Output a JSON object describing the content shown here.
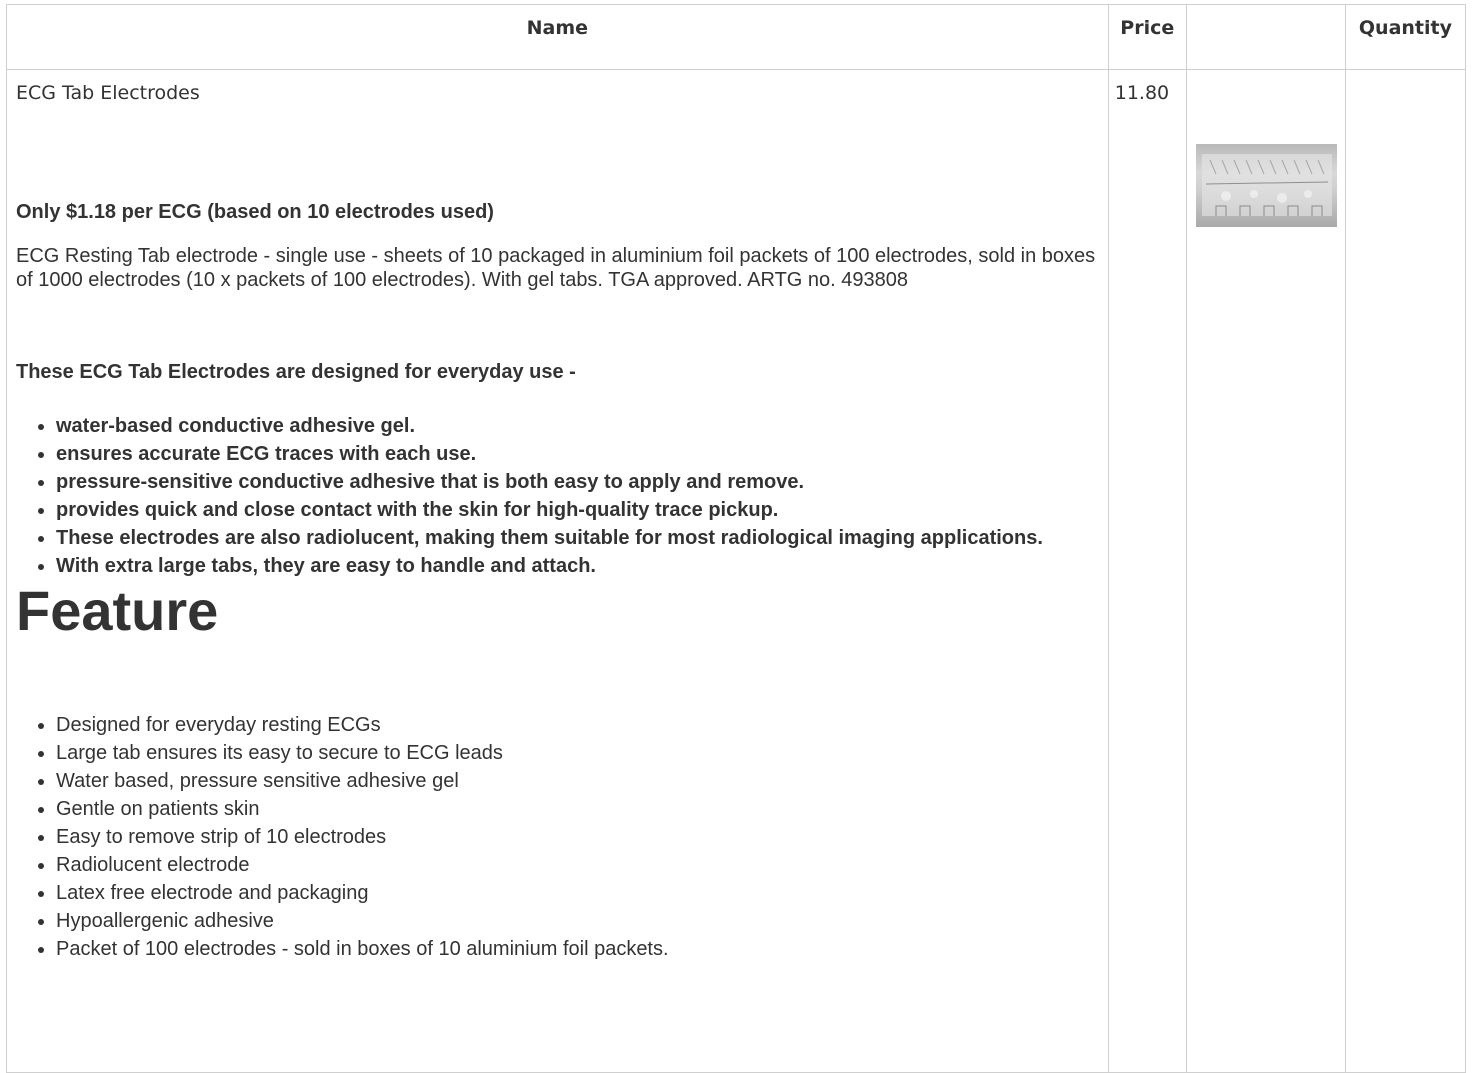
{
  "table": {
    "headers": {
      "name": "Name",
      "price": "Price",
      "image": "",
      "quantity": "Quantity"
    }
  },
  "product": {
    "name": "ECG Tab Electrodes",
    "price": "11.80",
    "image_icon": "electrode-sheet-photo",
    "highlight": "Only $1.18 per ECG (based on 10 electrodes used)",
    "paragraph": "ECG Resting Tab electrode - single use - sheets of 10 packaged in aluminium foil packets of 100 electrodes, sold in boxes of 1000 electrodes (10 x packets of 100 electrodes). With gel tabs. TGA approved. ARTG no. 493808",
    "designed_heading": "These ECG Tab Electrodes are designed for everyday use  -",
    "designed_points": [
      "water-based conductive adhesive gel.",
      "ensures accurate ECG traces with each use.",
      "pressure-sensitive conductive adhesive that is both easy to apply and remove.",
      "provides quick and close contact with the skin for high-quality trace pickup.",
      "These electrodes are also radiolucent, making them suitable for most radiological imaging applications.",
      "With extra large tabs, they are easy to handle and attach."
    ],
    "feature_heading": "Feature",
    "features": [
      "Designed for everyday resting ECGs",
      "Large tab ensures its easy to secure to ECG leads",
      "Water based, pressure sensitive adhesive gel",
      "Gentle on patients skin",
      "Easy to remove strip of 10 electrodes",
      "Radiolucent electrode",
      "Latex free electrode and packaging",
      "Hypoallergenic adhesive",
      "Packet of 100 electrodes - sold in boxes of 10 aluminium foil packets."
    ]
  }
}
